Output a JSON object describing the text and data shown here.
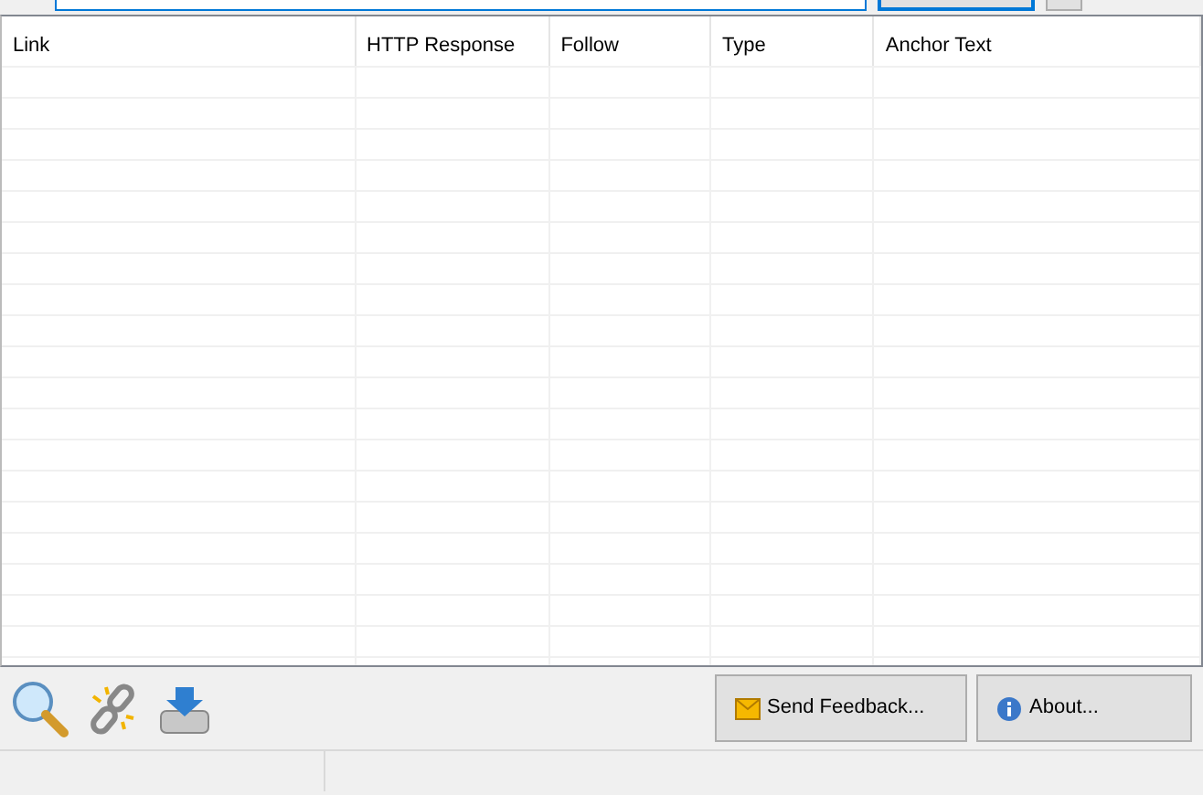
{
  "table": {
    "columns": [
      "Link",
      "HTTP Response",
      "Follow",
      "Type",
      "Anchor Text"
    ]
  },
  "buttons": [
    {
      "label": "Send Feedback...",
      "kind": "feedback"
    },
    {
      "label": "About...",
      "kind": "about"
    }
  ]
}
